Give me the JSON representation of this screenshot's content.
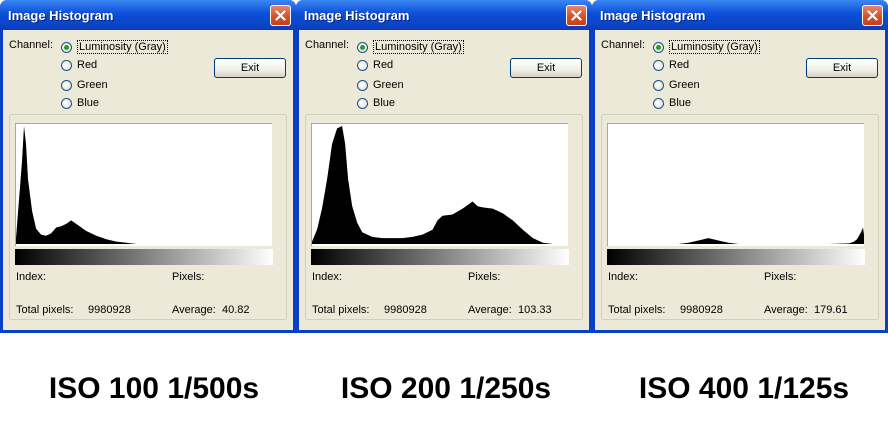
{
  "windows": [
    {
      "title": "Image Histogram",
      "channel_label": "Channel:",
      "channels": [
        "Luminosity (Gray)",
        "Red",
        "Green",
        "Blue"
      ],
      "selected_channel": "Luminosity (Gray)",
      "exit_label": "Exit",
      "index_label": "Index:",
      "pixels_label": "Pixels:",
      "total_pixels_label": "Total pixels:",
      "total_pixels": "9980928",
      "average_label": "Average:",
      "average": "40.82",
      "caption": "ISO 100 1/500s"
    },
    {
      "title": "Image Histogram",
      "channel_label": "Channel:",
      "channels": [
        "Luminosity (Gray)",
        "Red",
        "Green",
        "Blue"
      ],
      "selected_channel": "Luminosity (Gray)",
      "exit_label": "Exit",
      "index_label": "Index:",
      "pixels_label": "Pixels:",
      "total_pixels_label": "Total pixels:",
      "total_pixels": "9980928",
      "average_label": "Average:",
      "average": "103.33",
      "caption": "ISO 200 1/250s"
    },
    {
      "title": "Image Histogram",
      "channel_label": "Channel:",
      "channels": [
        "Luminosity (Gray)",
        "Red",
        "Green",
        "Blue"
      ],
      "selected_channel": "Luminosity (Gray)",
      "exit_label": "Exit",
      "index_label": "Index:",
      "pixels_label": "Pixels:",
      "total_pixels_label": "Total pixels:",
      "total_pixels": "9980928",
      "average_label": "Average:",
      "average": "179.61",
      "caption": "ISO 400 1/125s"
    }
  ],
  "icons": {
    "close": "close-icon"
  },
  "colors": {
    "title_bar": "#0a46c9",
    "close_button": "#d8512a",
    "window_face": "#ece9d8",
    "radio_dot": "#21a121"
  },
  "chart_data": [
    {
      "type": "area",
      "xlim": [
        0,
        255
      ],
      "ylim": [
        0,
        1
      ],
      "x": [
        0,
        6,
        8,
        10,
        12,
        16,
        20,
        25,
        30,
        35,
        40,
        45,
        50,
        55,
        60,
        65,
        70,
        75,
        80,
        90,
        100,
        110,
        120,
        130,
        140,
        160,
        180,
        200,
        220,
        240,
        255
      ],
      "values": [
        0.05,
        0.7,
        1.0,
        0.85,
        0.55,
        0.28,
        0.13,
        0.08,
        0.07,
        0.09,
        0.14,
        0.15,
        0.17,
        0.2,
        0.17,
        0.14,
        0.11,
        0.09,
        0.07,
        0.04,
        0.02,
        0.01,
        0,
        0,
        0,
        0,
        0,
        0,
        0,
        0,
        0
      ]
    },
    {
      "type": "area",
      "xlim": [
        0,
        255
      ],
      "ylim": [
        0,
        1
      ],
      "x": [
        0,
        5,
        10,
        15,
        20,
        25,
        30,
        33,
        36,
        40,
        45,
        50,
        60,
        70,
        80,
        90,
        100,
        110,
        120,
        125,
        130,
        140,
        150,
        160,
        165,
        170,
        180,
        190,
        200,
        210,
        220,
        230,
        240,
        255
      ],
      "values": [
        0.02,
        0.12,
        0.3,
        0.55,
        0.85,
        0.98,
        1.0,
        0.85,
        0.55,
        0.32,
        0.18,
        0.1,
        0.06,
        0.05,
        0.05,
        0.05,
        0.06,
        0.08,
        0.12,
        0.2,
        0.24,
        0.25,
        0.3,
        0.36,
        0.32,
        0.31,
        0.3,
        0.26,
        0.2,
        0.12,
        0.05,
        0.01,
        0,
        0
      ]
    },
    {
      "type": "area",
      "xlim": [
        0,
        255
      ],
      "ylim": [
        0,
        1
      ],
      "x": [
        0,
        20,
        40,
        60,
        70,
        80,
        90,
        100,
        110,
        120,
        130,
        140,
        160,
        180,
        200,
        220,
        240,
        245,
        248,
        250,
        252,
        254,
        255
      ],
      "values": [
        0,
        0,
        0,
        0,
        0,
        0.01,
        0.03,
        0.05,
        0.03,
        0.01,
        0,
        0,
        0,
        0,
        0,
        0,
        0.005,
        0.02,
        0.04,
        0.07,
        0.1,
        0.14,
        0.08
      ]
    }
  ]
}
